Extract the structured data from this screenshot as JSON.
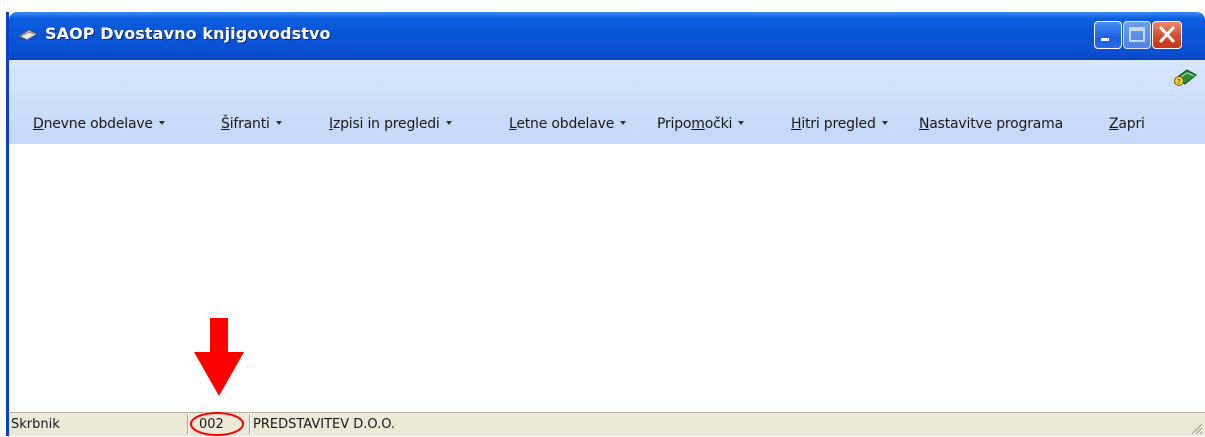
{
  "window": {
    "title": "SAOP Dvostavno knjigovodstvo"
  },
  "menu": {
    "items": [
      {
        "label": "Dnevne obdelave",
        "underline": "D",
        "rest": "nevne obdelave",
        "dropdown": true
      },
      {
        "label": "Šifranti",
        "underline": "Š",
        "rest": "ifranti",
        "prefix": "",
        "dropdown": true
      },
      {
        "label": "Izpisi in pregledi",
        "underline": "I",
        "rest": "zpisi in pregledi",
        "dropdown": true
      },
      {
        "label": "Letne obdelave",
        "underline": "L",
        "rest": "etne obdelave",
        "dropdown": true
      },
      {
        "label": "Pripomočki",
        "prefix": "Pripo",
        "underline": "m",
        "rest": "očki",
        "dropdown": true
      },
      {
        "label": "Hitri pregled",
        "underline": "H",
        "rest": "itri pregled",
        "dropdown": true
      },
      {
        "label": "Nastavitve programa",
        "underline": "N",
        "rest": "astavitve programa",
        "dropdown": false
      },
      {
        "label": "Zapri",
        "underline": "Z",
        "rest": "apri",
        "dropdown": false
      }
    ]
  },
  "statusbar": {
    "user": "Skrbnik",
    "company_code": "002",
    "company_name": "PREDSTAVITEV D.O.O."
  },
  "colors": {
    "titlebar": "#0a53d6",
    "menubar": "#c3d8f8",
    "annotation": "#ff0000"
  },
  "icons": [
    "app-icon",
    "minimize-icon",
    "maximize-icon",
    "close-icon",
    "help-book-icon",
    "down-arrow-annotation",
    "resize-grip-icon"
  ]
}
